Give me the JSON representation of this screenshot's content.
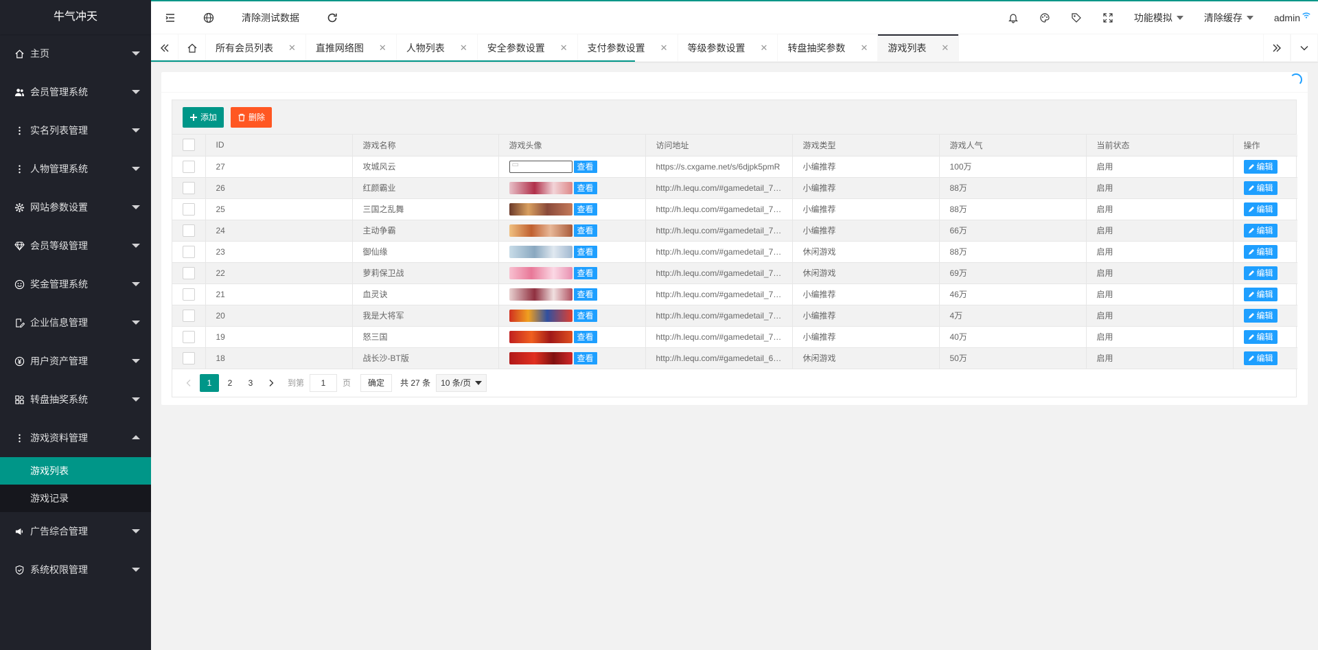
{
  "sidebar": {
    "logo": "牛气冲天",
    "items": [
      {
        "label": "主页",
        "icon": "home-icon"
      },
      {
        "label": "会员管理系统",
        "icon": "users-icon"
      },
      {
        "label": "实名列表管理",
        "icon": "more-vertical-icon"
      },
      {
        "label": "人物管理系统",
        "icon": "more-vertical-icon"
      },
      {
        "label": "网站参数设置",
        "icon": "gear-icon"
      },
      {
        "label": "会员等级管理",
        "icon": "diamond-icon"
      },
      {
        "label": "奖金管理系统",
        "icon": "smile-icon"
      },
      {
        "label": "企业信息管理",
        "icon": "edit-doc-icon"
      },
      {
        "label": "用户资产管理",
        "icon": "yen-icon"
      },
      {
        "label": "转盘抽奖系统",
        "icon": "grid-icon"
      },
      {
        "label": "游戏资料管理",
        "icon": "more-vertical-icon"
      }
    ],
    "sub_items": [
      "游戏列表",
      "游戏记录"
    ],
    "items_after": [
      {
        "label": "广告综合管理",
        "icon": "speaker-icon"
      },
      {
        "label": "系统权限管理",
        "icon": "shield-icon"
      }
    ]
  },
  "header": {
    "clear_test_data": "清除测试数据",
    "func_sim": "功能模拟",
    "clear_cache": "清除缓存",
    "user": "admin"
  },
  "tabs": [
    {
      "label": "所有会员列表"
    },
    {
      "label": "直推网络图"
    },
    {
      "label": "人物列表"
    },
    {
      "label": "安全参数设置"
    },
    {
      "label": "支付参数设置"
    },
    {
      "label": "等级参数设置"
    },
    {
      "label": "转盘抽奖参数"
    },
    {
      "label": "游戏列表"
    }
  ],
  "toolbar": {
    "add_label": "添加",
    "delete_label": "删除"
  },
  "table": {
    "headers": [
      "ID",
      "游戏名称",
      "游戏头像",
      "访问地址",
      "游戏类型",
      "游戏人气",
      "当前状态",
      "操作"
    ],
    "view_label": "查看",
    "edit_label": "编辑",
    "rows": [
      {
        "id": "27",
        "name": "攻城风云",
        "url": "https://s.cxgame.net/s/6djpk5pmR",
        "type": "小编推荐",
        "pop": "100万",
        "status": "启用",
        "thumb": ""
      },
      {
        "id": "26",
        "name": "红颜霸业",
        "url": "http://h.lequ.com/#gamedetail_7…",
        "type": "小编推荐",
        "pop": "88万",
        "status": "启用",
        "thumb": "linear-gradient(90deg,#e8c0c8,#b0304a 40%,#f2d4d8 70%,#d88)"
      },
      {
        "id": "25",
        "name": "三国之乱舞",
        "url": "http://h.lequ.com/#gamedetail_7…",
        "type": "小编推荐",
        "pop": "88万",
        "status": "启用",
        "thumb": "linear-gradient(90deg,#6b3a2a,#d9a060 30%,#8a4a3a 60%,#c47a5a)"
      },
      {
        "id": "24",
        "name": "主动争霸",
        "url": "http://h.lequ.com/#gamedetail_7…",
        "type": "小编推荐",
        "pop": "66万",
        "status": "启用",
        "thumb": "linear-gradient(90deg,#f0c080,#c06030 35%,#e8b898 65%,#a85a3a)"
      },
      {
        "id": "23",
        "name": "御仙缘",
        "url": "http://h.lequ.com/#gamedetail_7…",
        "type": "休闲游戏",
        "pop": "88万",
        "status": "启用",
        "thumb": "linear-gradient(90deg,#c8dce8,#8aa8c0 40%,#e0e8f0 70%,#a0b8d0)"
      },
      {
        "id": "22",
        "name": "萝莉保卫战",
        "url": "http://h.lequ.com/#gamedetail_7…",
        "type": "休闲游戏",
        "pop": "69万",
        "status": "启用",
        "thumb": "linear-gradient(90deg,#f8c0d0,#e87898 35%,#fbd8e4 70%,#e890b0)"
      },
      {
        "id": "21",
        "name": "血灵诀",
        "url": "http://h.lequ.com/#gamedetail_7…",
        "type": "小编推荐",
        "pop": "46万",
        "status": "启用",
        "thumb": "linear-gradient(90deg,#e8d0d0,#903040 40%,#f0e0e0 70%,#b05060)"
      },
      {
        "id": "20",
        "name": "我是大将军",
        "url": "http://h.lequ.com/#gamedetail_7…",
        "type": "小编推荐",
        "pop": "4万",
        "status": "启用",
        "thumb": "linear-gradient(90deg,#d03020,#f0a020 30%,#3050a0 60%,#e04030)"
      },
      {
        "id": "19",
        "name": "怒三国",
        "url": "http://h.lequ.com/#gamedetail_7…",
        "type": "小编推荐",
        "pop": "40万",
        "status": "启用",
        "thumb": "linear-gradient(90deg,#c02020,#f06020 35%,#a01818 65%,#e05020)"
      },
      {
        "id": "18",
        "name": "战长沙-BT版",
        "url": "http://h.lequ.com/#gamedetail_6…",
        "type": "休闲游戏",
        "pop": "50万",
        "status": "启用",
        "thumb": "linear-gradient(90deg,#b01818,#e03020 40%,#801010 70%,#d02828)"
      }
    ]
  },
  "pager": {
    "pages": [
      "1",
      "2",
      "3"
    ],
    "goto_label": "到第",
    "goto_value": "1",
    "page_unit": "页",
    "confirm": "确定",
    "total": "共 27 条",
    "per_page": "10 条/页"
  },
  "colors": {
    "accent": "#009688",
    "danger": "#ff5722",
    "info": "#1e9fff",
    "sidebar": "#20222a"
  }
}
